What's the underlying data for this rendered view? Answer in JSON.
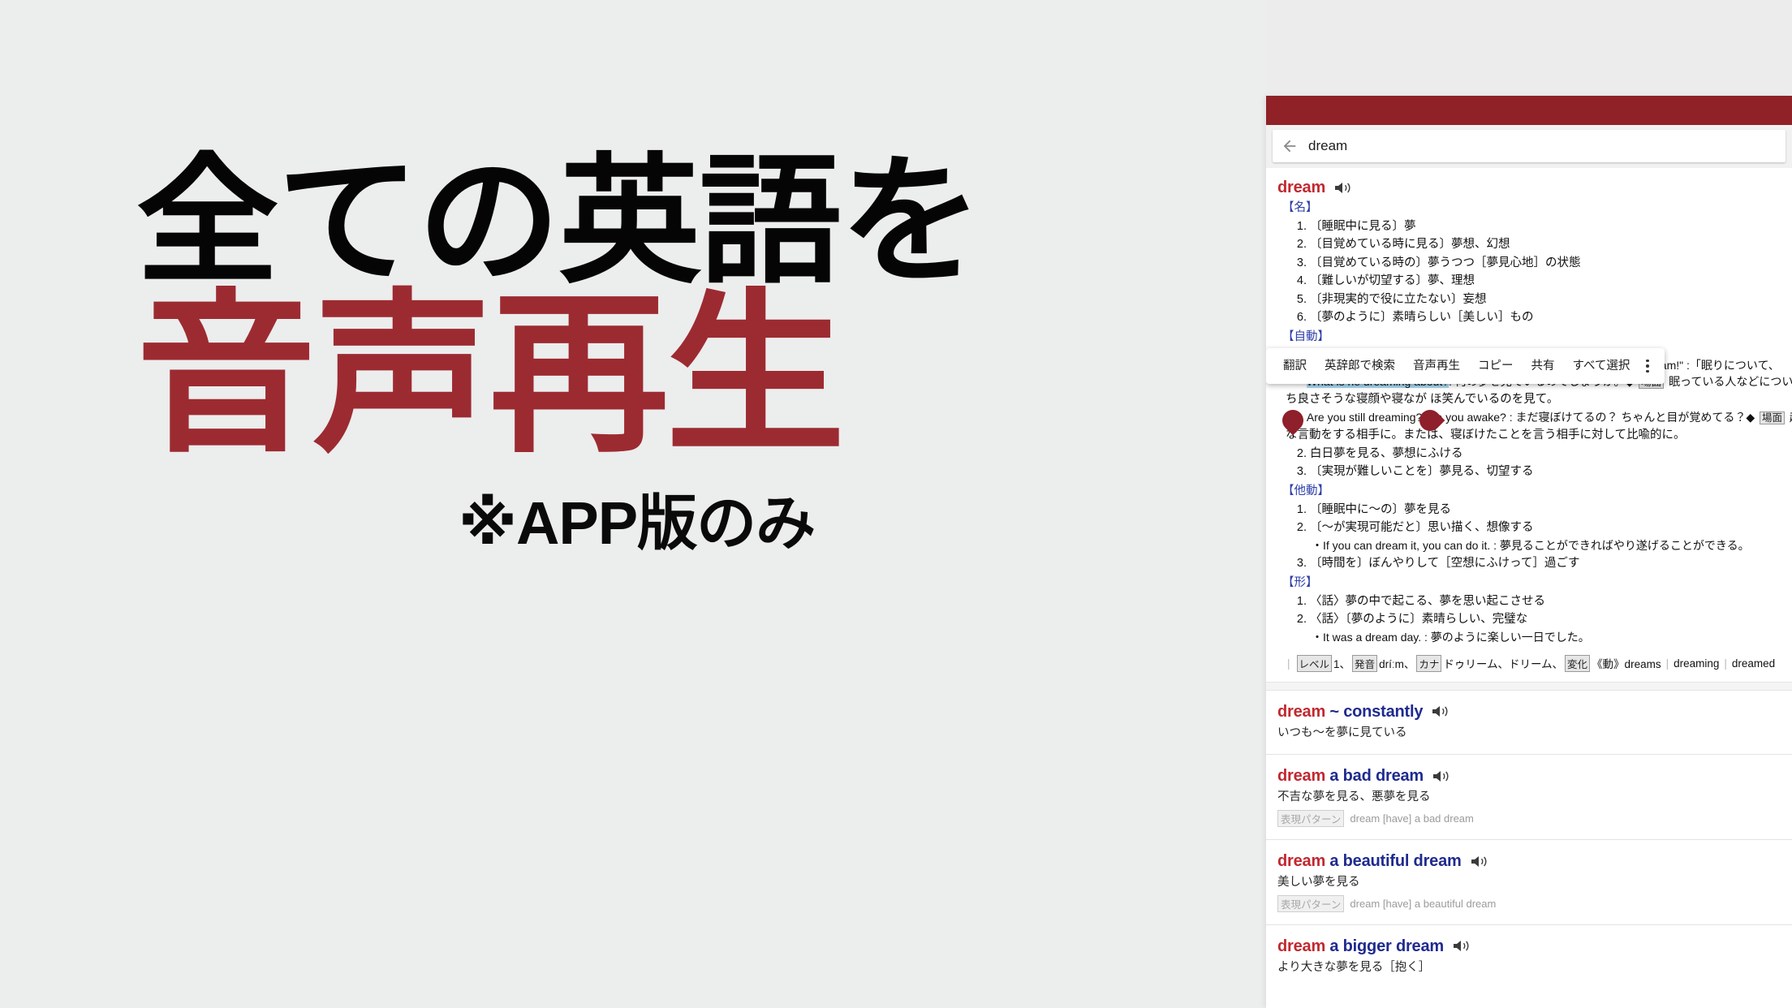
{
  "promo": {
    "line1": "全ての英語を",
    "line2": "音声再生",
    "subtitle": "※APP版のみ",
    "black": "#050505",
    "red": "#9c2b31",
    "background": "#eceded"
  },
  "app": {
    "statusbar_color": "#8f2127",
    "search": {
      "back_icon": "back-arrow-icon",
      "value": "dream"
    },
    "main_entry": {
      "headword": "dream",
      "speaker_icon": "speaker-icon",
      "pos_noun": "【名】",
      "noun_senses": [
        "〔睡眠中に見る〕夢",
        "〔目覚めている時に見る〕夢想、幻想",
        "〔目覚めている時の〕夢うつつ［夢見心地］の状態",
        "〔難しいが切望する〕夢、理想",
        "〔非現実的で役に立たない〕妄想",
        "〔夢のように〕素晴らしい［美しい］もの"
      ],
      "pos_intrans": "【自動】",
      "hidden_line": "e dream!\" :「眠りについて、",
      "example_selected": "What is he dreaming about?",
      "example_1_rest": ": 何の夢を見ているのでしょうか。◆",
      "example_1_tag": "場面",
      "example_1_tail": "眠っている人などについ",
      "example_1_cont": "ち良さそうな寝顔や寝なが     ほ笑んでいるのを見て。",
      "example_2": "・Are you still dreaming? Are you awake? : まだ寝ぼけてるの？ ちゃんと目が覚めてる？◆",
      "example_2_tag": "場面",
      "example_2_tail": "起",
      "example_2_cont": "な言動をする相手に。または、寝ぼけたことを言う相手に対して比喩的に。",
      "intrans_senses": [
        "白日夢を見る、夢想にふける",
        "〔実現が難しいことを〕夢見る、切望する"
      ],
      "intrans_start": 2,
      "pos_trans": "【他動】",
      "trans_senses": [
        "〔睡眠中に〜の〕夢を見る",
        "〔〜が実現可能だと〕思い描く、想像する",
        "〔時間を〕ぼんやりして［空想にふけって］過ごす"
      ],
      "trans_example": "・If you can dream it, you can do it. : 夢見ることができればやり遂げることができる。",
      "pos_adj": "【形】",
      "adj_senses": [
        "〈話〉夢の中で起こる、夢を思い起こさせる",
        "〈話〉〔夢のように〕素晴らしい、完璧な"
      ],
      "adj_example": "・It was a dream day. : 夢のように楽しい一日でした。",
      "level": {
        "level_tag": "レベル",
        "level_value": "1、",
        "pron_tag": "発音",
        "pron_value": "dríːm、",
        "kana_tag": "カナ",
        "kana_value": "ドゥリーム、ドリーム、",
        "infl_tag": "変化",
        "infl_value": "《動》dreams",
        "infl_2": "dreaming",
        "infl_3": "dreamed"
      }
    },
    "context_menu": {
      "items": [
        "翻訳",
        "英辞郎で検索",
        "音声再生",
        "コピー",
        "共有",
        "すべて選択"
      ],
      "overflow_icon": "more-vertical-icon"
    },
    "sub_entries": [
      {
        "head_red": "dream",
        "head_blue": "~ constantly",
        "speaker_icon": "speaker-icon",
        "jp": "いつも〜を夢に見ている",
        "pattern_tag": null,
        "pattern": null
      },
      {
        "head_red": "dream",
        "head_blue": "a bad dream",
        "speaker_icon": "speaker-icon",
        "jp": "不吉な夢を見る、悪夢を見る",
        "pattern_tag": "表現パターン",
        "pattern": "dream [have] a bad dream"
      },
      {
        "head_red": "dream",
        "head_blue": "a beautiful dream",
        "speaker_icon": "speaker-icon",
        "jp": "美しい夢を見る",
        "pattern_tag": "表現パターン",
        "pattern": "dream [have] a beautiful dream"
      },
      {
        "head_red": "dream",
        "head_blue": "a bigger dream",
        "speaker_icon": "speaker-icon",
        "jp": "より大きな夢を見る［抱く］",
        "pattern_tag": null,
        "pattern": null
      }
    ]
  }
}
